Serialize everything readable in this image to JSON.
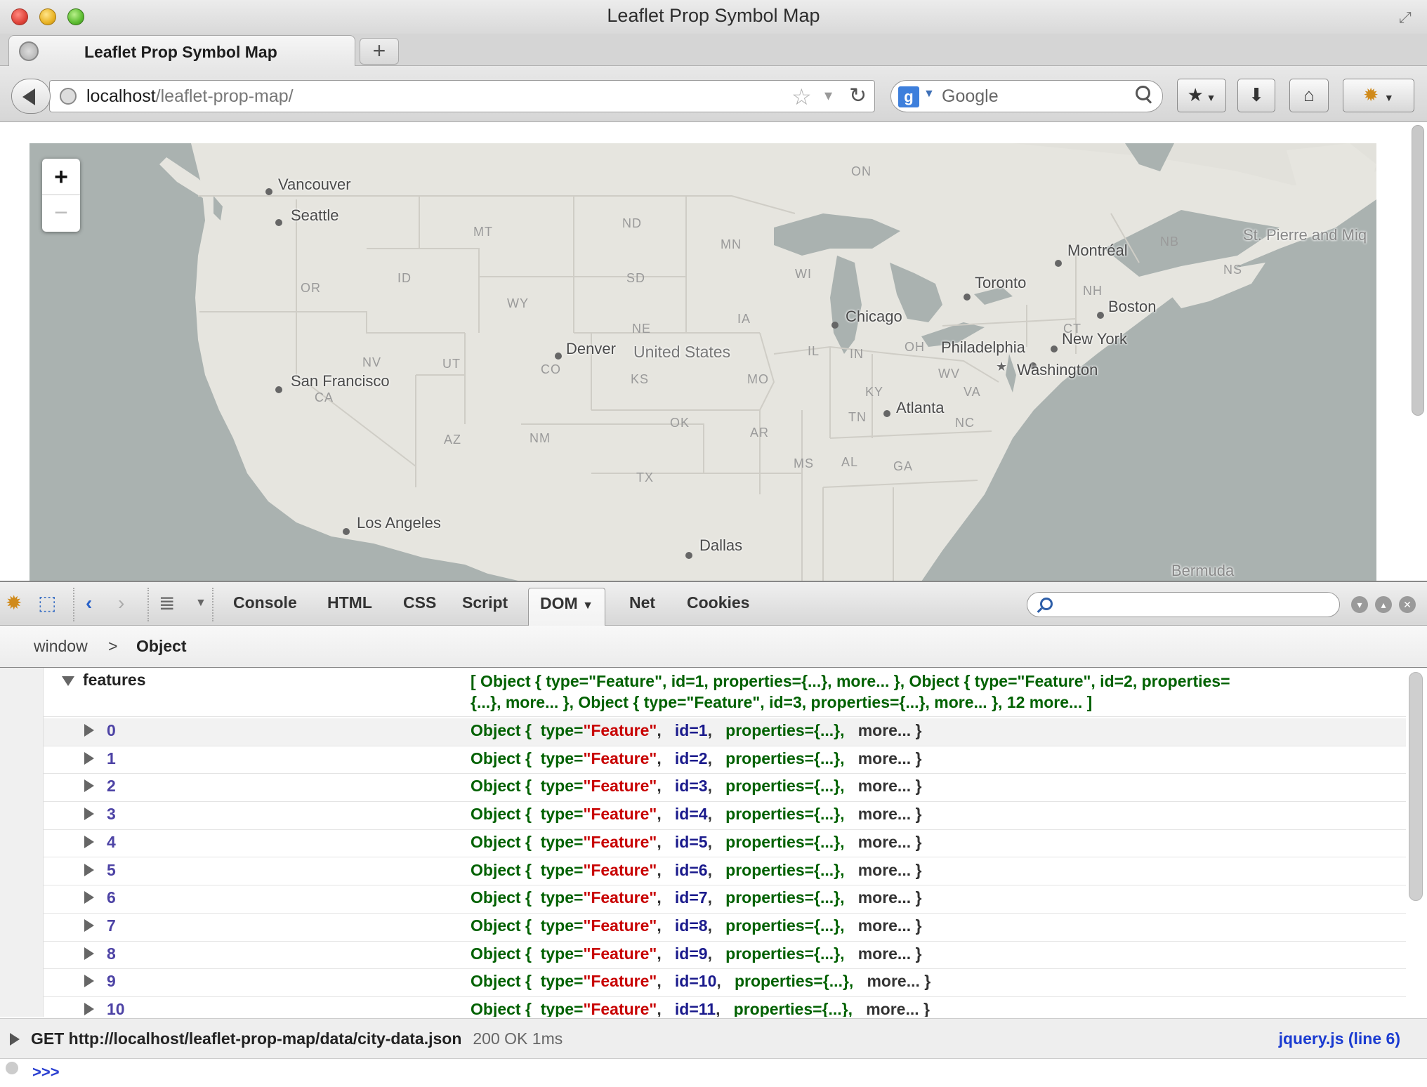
{
  "window": {
    "title": "Leaflet Prop Symbol Map"
  },
  "tab": {
    "label": "Leaflet Prop Symbol Map",
    "new_tab_label": "+"
  },
  "navbar": {
    "url_host": "localhost",
    "url_path": "/leaflet-prop-map/",
    "search_placeholder": "Google",
    "search_engine_letter": "g"
  },
  "map": {
    "zoom_in_label": "+",
    "zoom_out_label": "−",
    "cities": [
      "Vancouver",
      "Seattle",
      "San Francisco",
      "Los Angeles",
      "Denver",
      "Dallas",
      "Chicago",
      "Toronto",
      "Montréal",
      "Boston",
      "New York",
      "Philadelphia",
      "Washington",
      "Atlanta"
    ],
    "places": [
      "United States",
      "St. Pierre and Miq",
      "Bermuda",
      "CA"
    ],
    "states": [
      "ON",
      "MT",
      "ND",
      "MN",
      "OR",
      "ID",
      "SD",
      "WY",
      "WI",
      "NE",
      "IA",
      "NV",
      "UT",
      "CO",
      "KS",
      "MO",
      "IL",
      "IN",
      "OH",
      "KY",
      "WV",
      "VA",
      "OK",
      "AR",
      "TN",
      "NC",
      "NM",
      "AZ",
      "MS",
      "AL",
      "GA",
      "TX",
      "NB",
      "NH",
      "CT",
      "NS"
    ]
  },
  "firebug": {
    "tabs": [
      "Console",
      "HTML",
      "CSS",
      "Script",
      "DOM",
      "Net",
      "Cookies"
    ],
    "active_tab": "DOM",
    "breadcrumb": [
      "window",
      "Object"
    ],
    "features_key": "features",
    "features_summary_line1": "[ Object { type=\"Feature\", id=1, properties={...}, more... }, Object { type=\"Feature\", id=2, properties=",
    "features_summary_line2": "{...}, more... }, Object { type=\"Feature\", id=3, properties={...}, more... }, 12 more... ]",
    "rows": [
      {
        "index": "0",
        "id": "1"
      },
      {
        "index": "1",
        "id": "2"
      },
      {
        "index": "2",
        "id": "3"
      },
      {
        "index": "3",
        "id": "4"
      },
      {
        "index": "4",
        "id": "5"
      },
      {
        "index": "5",
        "id": "6"
      },
      {
        "index": "6",
        "id": "7"
      },
      {
        "index": "7",
        "id": "8"
      },
      {
        "index": "8",
        "id": "9"
      },
      {
        "index": "9",
        "id": "10"
      },
      {
        "index": "10",
        "id": "11"
      }
    ],
    "obj_word": "Object",
    "type_key": "type=",
    "type_value": "\"Feature\"",
    "id_key": "id=",
    "properties": "properties={...},",
    "more": "more...",
    "net_request": "GET http://localhost/leaflet-prop-map/data/city-data.json",
    "net_status": "200 OK 1ms",
    "net_source": "jquery.js (line 6)",
    "command_prompt": ">>>"
  }
}
